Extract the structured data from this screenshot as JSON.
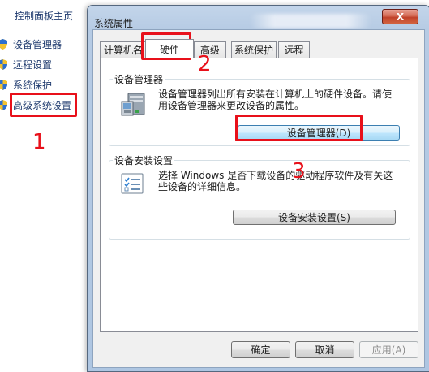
{
  "control_panel": {
    "home_label": "控制面板主页",
    "links": [
      {
        "label": "设备管理器"
      },
      {
        "label": "远程设置"
      },
      {
        "label": "系统保护"
      },
      {
        "label": "高级系统设置"
      }
    ]
  },
  "dialog": {
    "title": "系统属性",
    "close_label": "X",
    "tabs": [
      "计算机名",
      "硬件",
      "高级",
      "系统保护",
      "远程"
    ],
    "active_tab": "硬件",
    "device_manager_group": {
      "title": "设备管理器",
      "description_line1": "设备管理器列出所有安装在计算机上的硬件设备。请使",
      "description_line2": "用设备管理器来更改设备的属性。",
      "button_label": "设备管理器(D)"
    },
    "install_settings_group": {
      "title": "设备安装设置",
      "description_line1": "选择 Windows 是否下载设备的驱动程序软件及有关这",
      "description_line2": "些设备的详细信息。",
      "button_label": "设备安装设置(S)"
    },
    "footer": {
      "ok_label": "确定",
      "cancel_label": "取消",
      "apply_label": "应用(A)"
    }
  },
  "annotations": {
    "step1": "1",
    "step2": "2",
    "step3": "3",
    "highlight_color": "#e8101a"
  },
  "icons": {
    "shield": "uac-shield-icon",
    "device_manager": "computer-device-icon",
    "install_settings": "checklist-icon"
  }
}
